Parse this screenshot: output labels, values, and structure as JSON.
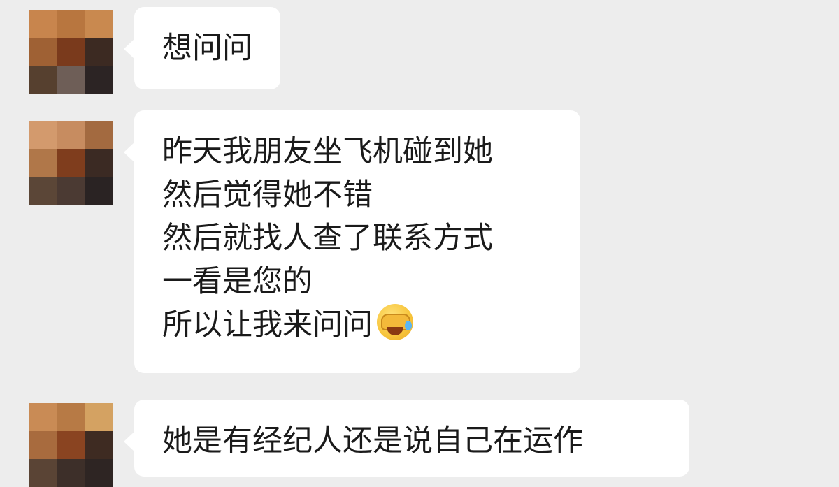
{
  "messages": [
    {
      "lines": [
        "想问问"
      ],
      "avatar_colors": [
        "#c8854d",
        "#b8763f",
        "#c9894f",
        "#9f6134",
        "#7a3a1c",
        "#3c2a22",
        "#56402f",
        "#6e5e57",
        "#2c2424"
      ]
    },
    {
      "lines": [
        "昨天我朋友坐飞机碰到她",
        "然后觉得她不错",
        "然后就找人查了联系方式",
        "一看是您的",
        "所以让我来问问"
      ],
      "trailing_emoji": "facepalm-laugh-emoji",
      "avatar_colors": [
        "#d39a6d",
        "#c78c60",
        "#a36a40",
        "#b07749",
        "#7f3d1d",
        "#3b2a23",
        "#5b4637",
        "#4b3a33",
        "#2a2323"
      ]
    },
    {
      "lines": [
        "她是有经纪人还是说自己在运作"
      ],
      "avatar_colors": [
        "#c98b55",
        "#b77a45",
        "#d4a262",
        "#a86b3e",
        "#8a4421",
        "#3e2b22",
        "#5a4435",
        "#3d2f29",
        "#2e2523"
      ]
    }
  ],
  "colors": {
    "background": "#ededed",
    "bubble": "#ffffff",
    "text": "#1a1a1a"
  }
}
